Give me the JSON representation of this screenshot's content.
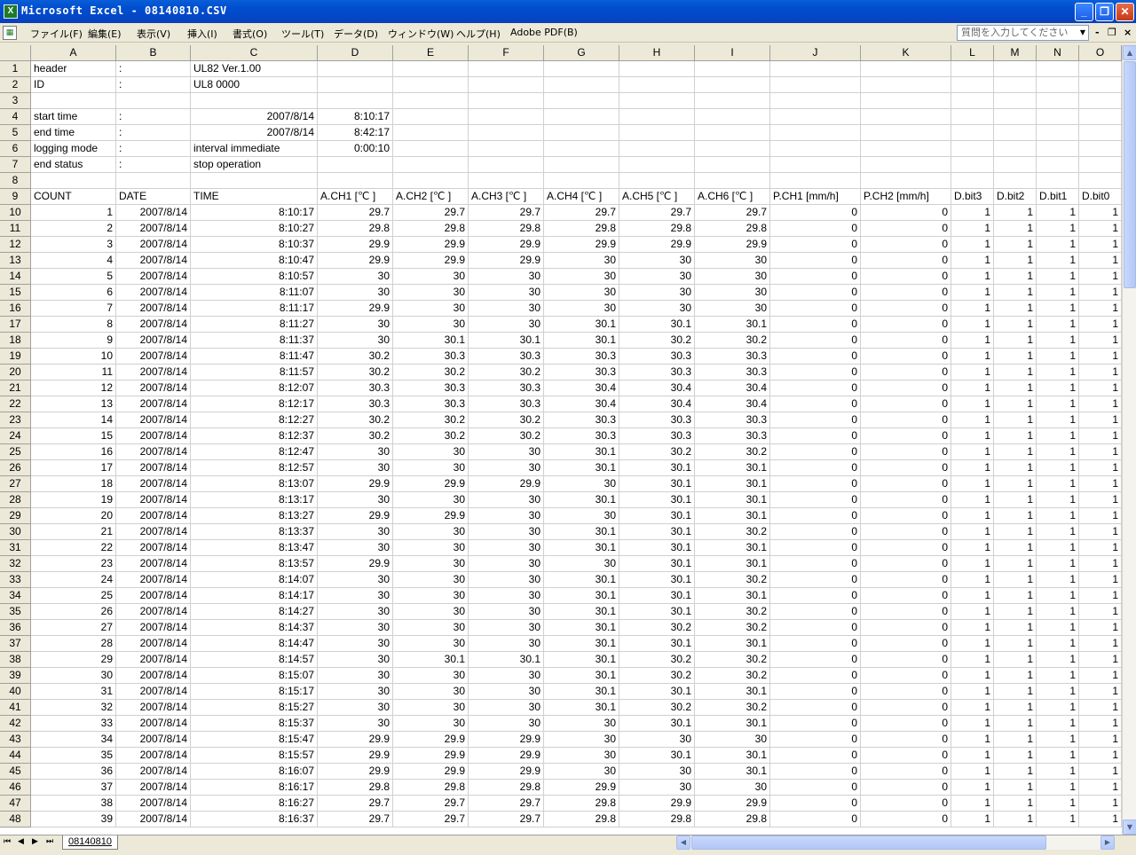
{
  "window": {
    "title": "Microsoft Excel - 08140810.CSV",
    "app_icon": "excel-icon",
    "controls": {
      "minimize": "_",
      "maximize": "❐",
      "close": "✕"
    }
  },
  "menubar": {
    "items": [
      "ファイル(F)",
      "編集(E)",
      "表示(V)",
      "挿入(I)",
      "書式(O)",
      "ツール(T)",
      "データ(D)",
      "ウィンドウ(W)",
      "ヘルプ(H)",
      "Adobe PDF(B)"
    ],
    "help_placeholder": "質問を入力してください",
    "doc_controls": {
      "minimize": "-",
      "restore": "❐",
      "close": "×"
    }
  },
  "columns": [
    "A",
    "B",
    "C",
    "D",
    "E",
    "F",
    "G",
    "H",
    "I",
    "J",
    "K",
    "L",
    "M",
    "N",
    "O"
  ],
  "rows": [
    {
      "n": "1",
      "A": "header",
      "B": ":",
      "C": "UL82   Ver.1.00"
    },
    {
      "n": "2",
      "A": "ID",
      "B": ":",
      "C": "UL8 0000"
    },
    {
      "n": "3"
    },
    {
      "n": "4",
      "A": "start time",
      "B": ":",
      "C": "2007/8/14",
      "D": "8:10:17"
    },
    {
      "n": "5",
      "A": "end time",
      "B": ":",
      "C": "2007/8/14",
      "D": "8:42:17"
    },
    {
      "n": "6",
      "A": "logging mode",
      "B": ":",
      "C": "interval immediate",
      "D": "0:00:10"
    },
    {
      "n": "7",
      "A": "end status",
      "B": ":",
      "C": "stop operation"
    },
    {
      "n": "8"
    },
    {
      "n": "9",
      "A": "COUNT",
      "B": "DATE",
      "C": "TIME",
      "D": "A.CH1 [℃ ]",
      "E": "A.CH2 [℃ ]",
      "F": "A.CH3 [℃ ]",
      "G": "A.CH4 [℃ ]",
      "H": "A.CH5 [℃ ]",
      "I": "A.CH6 [℃ ]",
      "J": "P.CH1 [mm/h]",
      "K": "P.CH2 [mm/h]",
      "L": "D.bit3",
      "M": "D.bit2",
      "N": "D.bit1",
      "O": "D.bit0"
    },
    {
      "n": "10",
      "A": "1",
      "B": "2007/8/14",
      "C": "8:10:17",
      "D": "29.7",
      "E": "29.7",
      "F": "29.7",
      "G": "29.7",
      "H": "29.7",
      "I": "29.7",
      "J": "0",
      "K": "0",
      "L": "1",
      "M": "1",
      "N": "1",
      "O": "1"
    },
    {
      "n": "11",
      "A": "2",
      "B": "2007/8/14",
      "C": "8:10:27",
      "D": "29.8",
      "E": "29.8",
      "F": "29.8",
      "G": "29.8",
      "H": "29.8",
      "I": "29.8",
      "J": "0",
      "K": "0",
      "L": "1",
      "M": "1",
      "N": "1",
      "O": "1"
    },
    {
      "n": "12",
      "A": "3",
      "B": "2007/8/14",
      "C": "8:10:37",
      "D": "29.9",
      "E": "29.9",
      "F": "29.9",
      "G": "29.9",
      "H": "29.9",
      "I": "29.9",
      "J": "0",
      "K": "0",
      "L": "1",
      "M": "1",
      "N": "1",
      "O": "1"
    },
    {
      "n": "13",
      "A": "4",
      "B": "2007/8/14",
      "C": "8:10:47",
      "D": "29.9",
      "E": "29.9",
      "F": "29.9",
      "G": "30",
      "H": "30",
      "I": "30",
      "J": "0",
      "K": "0",
      "L": "1",
      "M": "1",
      "N": "1",
      "O": "1"
    },
    {
      "n": "14",
      "A": "5",
      "B": "2007/8/14",
      "C": "8:10:57",
      "D": "30",
      "E": "30",
      "F": "30",
      "G": "30",
      "H": "30",
      "I": "30",
      "J": "0",
      "K": "0",
      "L": "1",
      "M": "1",
      "N": "1",
      "O": "1"
    },
    {
      "n": "15",
      "A": "6",
      "B": "2007/8/14",
      "C": "8:11:07",
      "D": "30",
      "E": "30",
      "F": "30",
      "G": "30",
      "H": "30",
      "I": "30",
      "J": "0",
      "K": "0",
      "L": "1",
      "M": "1",
      "N": "1",
      "O": "1"
    },
    {
      "n": "16",
      "A": "7",
      "B": "2007/8/14",
      "C": "8:11:17",
      "D": "29.9",
      "E": "30",
      "F": "30",
      "G": "30",
      "H": "30",
      "I": "30",
      "J": "0",
      "K": "0",
      "L": "1",
      "M": "1",
      "N": "1",
      "O": "1"
    },
    {
      "n": "17",
      "A": "8",
      "B": "2007/8/14",
      "C": "8:11:27",
      "D": "30",
      "E": "30",
      "F": "30",
      "G": "30.1",
      "H": "30.1",
      "I": "30.1",
      "J": "0",
      "K": "0",
      "L": "1",
      "M": "1",
      "N": "1",
      "O": "1"
    },
    {
      "n": "18",
      "A": "9",
      "B": "2007/8/14",
      "C": "8:11:37",
      "D": "30",
      "E": "30.1",
      "F": "30.1",
      "G": "30.1",
      "H": "30.2",
      "I": "30.2",
      "J": "0",
      "K": "0",
      "L": "1",
      "M": "1",
      "N": "1",
      "O": "1"
    },
    {
      "n": "19",
      "A": "10",
      "B": "2007/8/14",
      "C": "8:11:47",
      "D": "30.2",
      "E": "30.3",
      "F": "30.3",
      "G": "30.3",
      "H": "30.3",
      "I": "30.3",
      "J": "0",
      "K": "0",
      "L": "1",
      "M": "1",
      "N": "1",
      "O": "1"
    },
    {
      "n": "20",
      "A": "11",
      "B": "2007/8/14",
      "C": "8:11:57",
      "D": "30.2",
      "E": "30.2",
      "F": "30.2",
      "G": "30.3",
      "H": "30.3",
      "I": "30.3",
      "J": "0",
      "K": "0",
      "L": "1",
      "M": "1",
      "N": "1",
      "O": "1"
    },
    {
      "n": "21",
      "A": "12",
      "B": "2007/8/14",
      "C": "8:12:07",
      "D": "30.3",
      "E": "30.3",
      "F": "30.3",
      "G": "30.4",
      "H": "30.4",
      "I": "30.4",
      "J": "0",
      "K": "0",
      "L": "1",
      "M": "1",
      "N": "1",
      "O": "1"
    },
    {
      "n": "22",
      "A": "13",
      "B": "2007/8/14",
      "C": "8:12:17",
      "D": "30.3",
      "E": "30.3",
      "F": "30.3",
      "G": "30.4",
      "H": "30.4",
      "I": "30.4",
      "J": "0",
      "K": "0",
      "L": "1",
      "M": "1",
      "N": "1",
      "O": "1"
    },
    {
      "n": "23",
      "A": "14",
      "B": "2007/8/14",
      "C": "8:12:27",
      "D": "30.2",
      "E": "30.2",
      "F": "30.2",
      "G": "30.3",
      "H": "30.3",
      "I": "30.3",
      "J": "0",
      "K": "0",
      "L": "1",
      "M": "1",
      "N": "1",
      "O": "1"
    },
    {
      "n": "24",
      "A": "15",
      "B": "2007/8/14",
      "C": "8:12:37",
      "D": "30.2",
      "E": "30.2",
      "F": "30.2",
      "G": "30.3",
      "H": "30.3",
      "I": "30.3",
      "J": "0",
      "K": "0",
      "L": "1",
      "M": "1",
      "N": "1",
      "O": "1"
    },
    {
      "n": "25",
      "A": "16",
      "B": "2007/8/14",
      "C": "8:12:47",
      "D": "30",
      "E": "30",
      "F": "30",
      "G": "30.1",
      "H": "30.2",
      "I": "30.2",
      "J": "0",
      "K": "0",
      "L": "1",
      "M": "1",
      "N": "1",
      "O": "1"
    },
    {
      "n": "26",
      "A": "17",
      "B": "2007/8/14",
      "C": "8:12:57",
      "D": "30",
      "E": "30",
      "F": "30",
      "G": "30.1",
      "H": "30.1",
      "I": "30.1",
      "J": "0",
      "K": "0",
      "L": "1",
      "M": "1",
      "N": "1",
      "O": "1"
    },
    {
      "n": "27",
      "A": "18",
      "B": "2007/8/14",
      "C": "8:13:07",
      "D": "29.9",
      "E": "29.9",
      "F": "29.9",
      "G": "30",
      "H": "30.1",
      "I": "30.1",
      "J": "0",
      "K": "0",
      "L": "1",
      "M": "1",
      "N": "1",
      "O": "1"
    },
    {
      "n": "28",
      "A": "19",
      "B": "2007/8/14",
      "C": "8:13:17",
      "D": "30",
      "E": "30",
      "F": "30",
      "G": "30.1",
      "H": "30.1",
      "I": "30.1",
      "J": "0",
      "K": "0",
      "L": "1",
      "M": "1",
      "N": "1",
      "O": "1"
    },
    {
      "n": "29",
      "A": "20",
      "B": "2007/8/14",
      "C": "8:13:27",
      "D": "29.9",
      "E": "29.9",
      "F": "30",
      "G": "30",
      "H": "30.1",
      "I": "30.1",
      "J": "0",
      "K": "0",
      "L": "1",
      "M": "1",
      "N": "1",
      "O": "1"
    },
    {
      "n": "30",
      "A": "21",
      "B": "2007/8/14",
      "C": "8:13:37",
      "D": "30",
      "E": "30",
      "F": "30",
      "G": "30.1",
      "H": "30.1",
      "I": "30.2",
      "J": "0",
      "K": "0",
      "L": "1",
      "M": "1",
      "N": "1",
      "O": "1"
    },
    {
      "n": "31",
      "A": "22",
      "B": "2007/8/14",
      "C": "8:13:47",
      "D": "30",
      "E": "30",
      "F": "30",
      "G": "30.1",
      "H": "30.1",
      "I": "30.1",
      "J": "0",
      "K": "0",
      "L": "1",
      "M": "1",
      "N": "1",
      "O": "1"
    },
    {
      "n": "32",
      "A": "23",
      "B": "2007/8/14",
      "C": "8:13:57",
      "D": "29.9",
      "E": "30",
      "F": "30",
      "G": "30",
      "H": "30.1",
      "I": "30.1",
      "J": "0",
      "K": "0",
      "L": "1",
      "M": "1",
      "N": "1",
      "O": "1"
    },
    {
      "n": "33",
      "A": "24",
      "B": "2007/8/14",
      "C": "8:14:07",
      "D": "30",
      "E": "30",
      "F": "30",
      "G": "30.1",
      "H": "30.1",
      "I": "30.2",
      "J": "0",
      "K": "0",
      "L": "1",
      "M": "1",
      "N": "1",
      "O": "1"
    },
    {
      "n": "34",
      "A": "25",
      "B": "2007/8/14",
      "C": "8:14:17",
      "D": "30",
      "E": "30",
      "F": "30",
      "G": "30.1",
      "H": "30.1",
      "I": "30.1",
      "J": "0",
      "K": "0",
      "L": "1",
      "M": "1",
      "N": "1",
      "O": "1"
    },
    {
      "n": "35",
      "A": "26",
      "B": "2007/8/14",
      "C": "8:14:27",
      "D": "30",
      "E": "30",
      "F": "30",
      "G": "30.1",
      "H": "30.1",
      "I": "30.2",
      "J": "0",
      "K": "0",
      "L": "1",
      "M": "1",
      "N": "1",
      "O": "1"
    },
    {
      "n": "36",
      "A": "27",
      "B": "2007/8/14",
      "C": "8:14:37",
      "D": "30",
      "E": "30",
      "F": "30",
      "G": "30.1",
      "H": "30.2",
      "I": "30.2",
      "J": "0",
      "K": "0",
      "L": "1",
      "M": "1",
      "N": "1",
      "O": "1"
    },
    {
      "n": "37",
      "A": "28",
      "B": "2007/8/14",
      "C": "8:14:47",
      "D": "30",
      "E": "30",
      "F": "30",
      "G": "30.1",
      "H": "30.1",
      "I": "30.1",
      "J": "0",
      "K": "0",
      "L": "1",
      "M": "1",
      "N": "1",
      "O": "1"
    },
    {
      "n": "38",
      "A": "29",
      "B": "2007/8/14",
      "C": "8:14:57",
      "D": "30",
      "E": "30.1",
      "F": "30.1",
      "G": "30.1",
      "H": "30.2",
      "I": "30.2",
      "J": "0",
      "K": "0",
      "L": "1",
      "M": "1",
      "N": "1",
      "O": "1"
    },
    {
      "n": "39",
      "A": "30",
      "B": "2007/8/14",
      "C": "8:15:07",
      "D": "30",
      "E": "30",
      "F": "30",
      "G": "30.1",
      "H": "30.2",
      "I": "30.2",
      "J": "0",
      "K": "0",
      "L": "1",
      "M": "1",
      "N": "1",
      "O": "1"
    },
    {
      "n": "40",
      "A": "31",
      "B": "2007/8/14",
      "C": "8:15:17",
      "D": "30",
      "E": "30",
      "F": "30",
      "G": "30.1",
      "H": "30.1",
      "I": "30.1",
      "J": "0",
      "K": "0",
      "L": "1",
      "M": "1",
      "N": "1",
      "O": "1"
    },
    {
      "n": "41",
      "A": "32",
      "B": "2007/8/14",
      "C": "8:15:27",
      "D": "30",
      "E": "30",
      "F": "30",
      "G": "30.1",
      "H": "30.2",
      "I": "30.2",
      "J": "0",
      "K": "0",
      "L": "1",
      "M": "1",
      "N": "1",
      "O": "1"
    },
    {
      "n": "42",
      "A": "33",
      "B": "2007/8/14",
      "C": "8:15:37",
      "D": "30",
      "E": "30",
      "F": "30",
      "G": "30",
      "H": "30.1",
      "I": "30.1",
      "J": "0",
      "K": "0",
      "L": "1",
      "M": "1",
      "N": "1",
      "O": "1"
    },
    {
      "n": "43",
      "A": "34",
      "B": "2007/8/14",
      "C": "8:15:47",
      "D": "29.9",
      "E": "29.9",
      "F": "29.9",
      "G": "30",
      "H": "30",
      "I": "30",
      "J": "0",
      "K": "0",
      "L": "1",
      "M": "1",
      "N": "1",
      "O": "1"
    },
    {
      "n": "44",
      "A": "35",
      "B": "2007/8/14",
      "C": "8:15:57",
      "D": "29.9",
      "E": "29.9",
      "F": "29.9",
      "G": "30",
      "H": "30.1",
      "I": "30.1",
      "J": "0",
      "K": "0",
      "L": "1",
      "M": "1",
      "N": "1",
      "O": "1"
    },
    {
      "n": "45",
      "A": "36",
      "B": "2007/8/14",
      "C": "8:16:07",
      "D": "29.9",
      "E": "29.9",
      "F": "29.9",
      "G": "30",
      "H": "30",
      "I": "30.1",
      "J": "0",
      "K": "0",
      "L": "1",
      "M": "1",
      "N": "1",
      "O": "1"
    },
    {
      "n": "46",
      "A": "37",
      "B": "2007/8/14",
      "C": "8:16:17",
      "D": "29.8",
      "E": "29.8",
      "F": "29.8",
      "G": "29.9",
      "H": "30",
      "I": "30",
      "J": "0",
      "K": "0",
      "L": "1",
      "M": "1",
      "N": "1",
      "O": "1"
    },
    {
      "n": "47",
      "A": "38",
      "B": "2007/8/14",
      "C": "8:16:27",
      "D": "29.7",
      "E": "29.7",
      "F": "29.7",
      "G": "29.8",
      "H": "29.9",
      "I": "29.9",
      "J": "0",
      "K": "0",
      "L": "1",
      "M": "1",
      "N": "1",
      "O": "1"
    },
    {
      "n": "48",
      "A": "39",
      "B": "2007/8/14",
      "C": "8:16:37",
      "D": "29.7",
      "E": "29.7",
      "F": "29.7",
      "G": "29.8",
      "H": "29.8",
      "I": "29.8",
      "J": "0",
      "K": "0",
      "L": "1",
      "M": "1",
      "N": "1",
      "O": "1"
    }
  ],
  "sheet": {
    "tab_label": "08140810",
    "nav": [
      "⏮",
      "◀",
      "▶",
      "⏭"
    ]
  },
  "colors": {
    "title_bar": "#0a5ed8",
    "chrome": "#ece9d8",
    "grid_line": "#d0d0d0"
  }
}
